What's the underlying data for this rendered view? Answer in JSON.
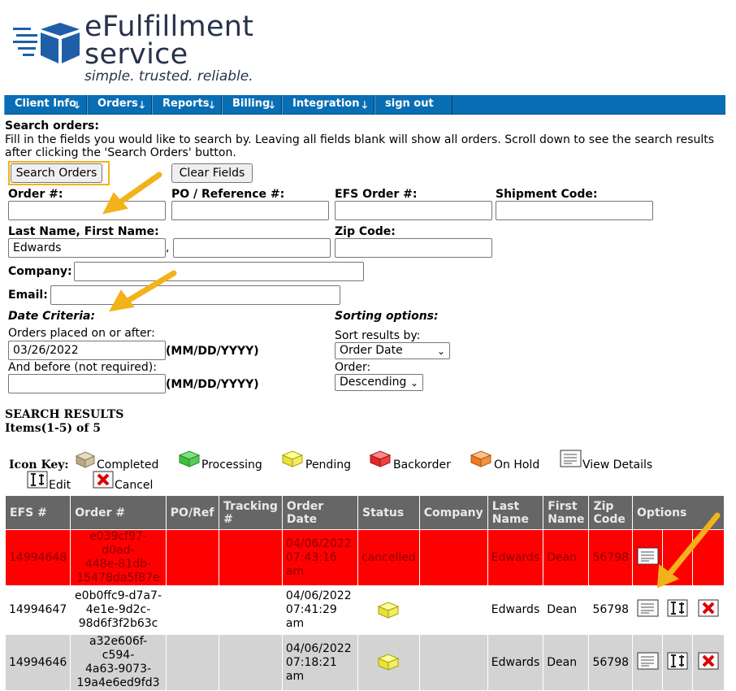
{
  "brand": {
    "line1": "eFulfillment",
    "line2": "service",
    "tagline": "simple. trusted. reliable."
  },
  "nav": [
    {
      "label": "Client Info",
      "has_menu": true
    },
    {
      "label": "Orders",
      "has_menu": true
    },
    {
      "label": "Reports",
      "has_menu": true
    },
    {
      "label": "Billing",
      "has_menu": true
    },
    {
      "label": "Integration",
      "has_menu": true
    },
    {
      "label": "sign out",
      "has_menu": false
    }
  ],
  "search": {
    "heading": "Search orders:",
    "instructions_line1": "Fill in the fields you would like to search by. Leaving all fields blank will show all orders. Scroll down to see the search results",
    "instructions_line2": "after clicking the 'Search Orders' button.",
    "search_button": "Search Orders",
    "clear_button": "Clear Fields",
    "labels": {
      "order": "Order #:",
      "po": "PO / Reference #:",
      "efs_order": "EFS Order #:",
      "shipment": "Shipment Code:",
      "name": "Last Name, First Name:",
      "zip": "Zip Code:",
      "company": "Company:",
      "email": "Email:"
    },
    "values": {
      "order": "",
      "po": "",
      "efs_order": "",
      "shipment": "",
      "last_name": "Edwards",
      "first_name": "",
      "zip": "",
      "company": "",
      "email": ""
    },
    "name_separator": ","
  },
  "date_criteria": {
    "heading": "Date Criteria:",
    "after_label": "Orders placed on or after:",
    "after_value": "03/26/2022",
    "before_label": "And before (not required):",
    "before_value": "",
    "format_hint": "(MM/DD/YYYY)"
  },
  "sorting": {
    "heading": "Sorting options:",
    "sort_label": "Sort results by:",
    "sort_value": "Order Date",
    "order_label": "Order:",
    "order_value": "Descending"
  },
  "results": {
    "heading": "SEARCH RESULTS",
    "count": "Items(1-5) of 5",
    "icon_key": {
      "title": "Icon Key:",
      "completed": "Completed",
      "processing": "Processing",
      "pending": "Pending",
      "backorder": "Backorder",
      "on_hold": "On Hold",
      "view_details": "View Details",
      "edit": "Edit",
      "cancel": "Cancel"
    },
    "columns": [
      "EFS #",
      "Order #",
      "PO/Ref",
      "Tracking #",
      "Order Date",
      "Status",
      "Company",
      "Last Name",
      "First Name",
      "Zip Code",
      "Options"
    ],
    "rows": [
      {
        "efs": "14994648",
        "order_l1": "e039cf97-d0ad-",
        "order_l2": "448e-81db-",
        "order_l3": "15478da5f87e",
        "po": "",
        "tracking": "",
        "date_l1": "04/06/2022",
        "date_l2": "07:43:16",
        "date_l3": "am",
        "status": "cancelled",
        "company": "",
        "last": "Edwards",
        "first": "Dean",
        "zip": "56798"
      },
      {
        "efs": "14994647",
        "order_l1": "e0b0ffc9-d7a7-",
        "order_l2": "4e1e-9d2c-",
        "order_l3": "98d6f3f2b63c",
        "po": "",
        "tracking": "",
        "date_l1": "04/06/2022",
        "date_l2": "07:41:29",
        "date_l3": "am",
        "status": "",
        "company": "",
        "last": "Edwards",
        "first": "Dean",
        "zip": "56798"
      },
      {
        "efs": "14994646",
        "order_l1": "a32e606f-c594-",
        "order_l2": "4a63-9073-",
        "order_l3": "19a4e6ed9fd3",
        "po": "",
        "tracking": "",
        "date_l1": "04/06/2022",
        "date_l2": "07:18:21",
        "date_l3": "am",
        "status": "",
        "company": "",
        "last": "Edwards",
        "first": "Dean",
        "zip": "56798"
      }
    ]
  },
  "colors": {
    "nav_blue": "#0a6eb4",
    "header_grey": "#666666",
    "cancelled_red": "#ff0000",
    "alt_row_grey": "#d3d3d3",
    "annotation_arrow": "#f2b21a",
    "logo_navy": "#26334a"
  }
}
